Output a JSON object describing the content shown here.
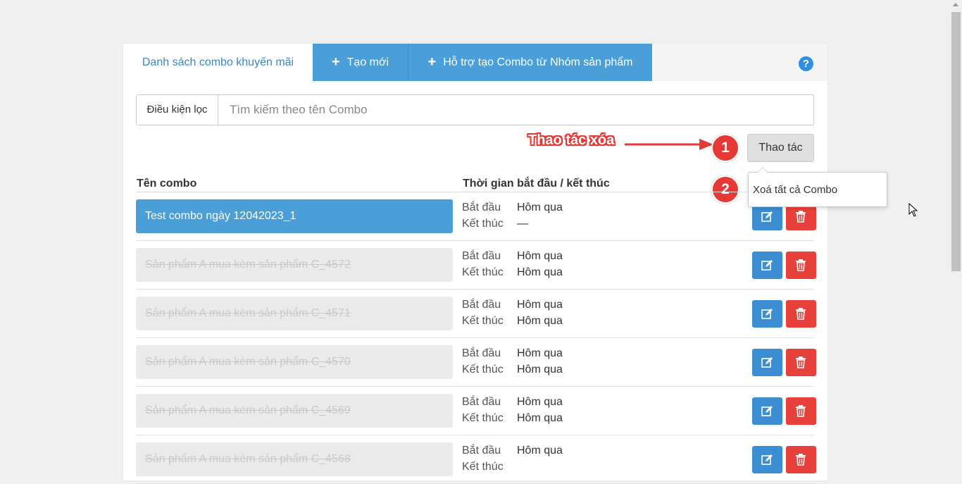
{
  "tabs": {
    "list": "Danh sách combo khuyến mãi",
    "create": "Tạo mới",
    "create_from_group": "Hỗ trợ tạo Combo từ Nhóm sản phẩm"
  },
  "help": "?",
  "filter": {
    "label": "Điều kiện lọc",
    "placeholder": "Tìm kiếm theo tên Combo"
  },
  "actions": {
    "button": "Thao tác",
    "menu_item": "Xoá tất cả Combo"
  },
  "annotation": {
    "text": "Thao tác xóa",
    "step1": "1",
    "step2": "2"
  },
  "table": {
    "col_name": "Tên combo",
    "col_time": "Thời gian bắt đầu / kết thúc",
    "start_label": "Bắt đầu",
    "end_label": "Kết thúc",
    "rows": [
      {
        "name": "Test combo ngày 12042023_1",
        "start": "Hôm qua",
        "end": "—"
      },
      {
        "name": "Sản phẩm A mua kèm sản phẩm C_4572",
        "start": "Hôm qua",
        "end": "Hôm qua"
      },
      {
        "name": "Sản phẩm A mua kèm sản phẩm C_4571",
        "start": "Hôm qua",
        "end": "Hôm qua"
      },
      {
        "name": "Sản phẩm A mua kèm sản phẩm C_4570",
        "start": "Hôm qua",
        "end": "Hôm qua"
      },
      {
        "name": "Sản phẩm A mua kèm sản phẩm C_4569",
        "start": "Hôm qua",
        "end": "Hôm qua"
      },
      {
        "name": "Sản phẩm A mua kèm sản phẩm C_4568",
        "start": "Hôm qua",
        "end": ""
      }
    ]
  },
  "colors": {
    "accent": "#4a9fd8",
    "edit": "#3b8ed2",
    "delete": "#e8403a",
    "annotation": "#e53935"
  }
}
